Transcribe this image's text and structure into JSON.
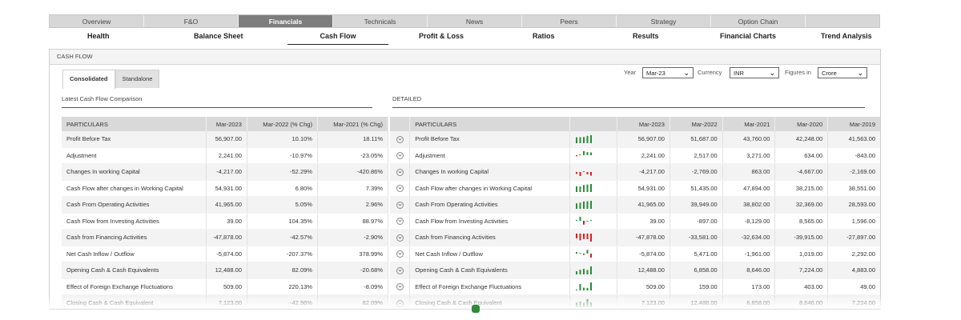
{
  "main_tabs": [
    {
      "label": "Overview"
    },
    {
      "label": "F&O"
    },
    {
      "label": "Financials"
    },
    {
      "label": "Technicals"
    },
    {
      "label": "News"
    },
    {
      "label": "Peers"
    },
    {
      "label": "Strategy"
    },
    {
      "label": "Option Chain"
    },
    {
      "label": ""
    }
  ],
  "sub_tabs": [
    {
      "label": "Health"
    },
    {
      "label": "Balance Sheet"
    },
    {
      "label": "Cash Flow"
    },
    {
      "label": "Profit & Loss"
    },
    {
      "label": "Ratios"
    },
    {
      "label": "Results"
    },
    {
      "label": "Financial Charts"
    },
    {
      "label": "Trend Analysis"
    }
  ],
  "panel_title": "CASH FLOW",
  "view_tabs": [
    {
      "label": "Consolidated"
    },
    {
      "label": "Standalone"
    }
  ],
  "controls": {
    "year_label": "Year",
    "year_value": "Mar-23",
    "currency_label": "Currency",
    "currency_value": "INR",
    "figures_label": "Figures in",
    "figures_value": "Crore"
  },
  "comparison": {
    "title": "Latest Cash Flow Comparison",
    "headers": [
      "PARTICULARS",
      "Mar-2023",
      "Mar-2022 (% Chg)",
      "Mar-2021 (% Chg)"
    ],
    "rows": [
      [
        "Profit Before Tax",
        "56,907.00",
        "10.10%",
        "18.11%"
      ],
      [
        "Adjustment",
        "2,241.00",
        "-10.97%",
        "-23.05%"
      ],
      [
        "Changes In working Capital",
        "-4,217.00",
        "-52.29%",
        "-420.86%"
      ],
      [
        "Cash Flow after changes in Working Capital",
        "54,931.00",
        "6.80%",
        "7.39%"
      ],
      [
        "Cash From Operating Activities",
        "41,965.00",
        "5.05%",
        "2.96%"
      ],
      [
        "Cash Flow from Investing Activities",
        "39.00",
        "104.35%",
        "88.97%"
      ],
      [
        "Cash from Financing Activities",
        "-47,878.00",
        "-42.57%",
        "-2.90%"
      ],
      [
        "Net Cash Inflow / Outflow",
        "-5,874.00",
        "-207.37%",
        "378.99%"
      ],
      [
        "Opening Cash & Cash Equivalents",
        "12,488.00",
        "82.09%",
        "-20.68%"
      ],
      [
        "Effect of Foreign Exchange Fluctuations",
        "509.00",
        "220.13%",
        "-8.09%"
      ],
      [
        "Closing Cash & Cash Equivalent",
        "7,123.00",
        "-42.96%",
        "82.09%"
      ]
    ]
  },
  "detailed": {
    "title": "DETAILED",
    "headers": [
      "PARTICULARS",
      "Mar-2023",
      "Mar-2022",
      "Mar-2021",
      "Mar-2020",
      "Mar-2019"
    ],
    "rows": [
      {
        "name": "Profit Before Tax",
        "values": [
          "56,907.00",
          "51,687.00",
          "43,760.00",
          "42,248.00",
          "41,563.00"
        ],
        "trend": [
          41563,
          42248,
          43760,
          51687,
          56907
        ]
      },
      {
        "name": "Adjustment",
        "values": [
          "2,241.00",
          "2,517.00",
          "3,271.00",
          "634.00",
          "-843.00"
        ],
        "trend": [
          -843,
          634,
          3271,
          2517,
          2241
        ]
      },
      {
        "name": "Changes In working Capital",
        "values": [
          "-4,217.00",
          "-2,769.00",
          "863.00",
          "-4,667.00",
          "-2,169.00"
        ],
        "trend": [
          -2169,
          -4667,
          863,
          -2769,
          -4217
        ]
      },
      {
        "name": "Cash Flow after changes in Working Capital",
        "values": [
          "54,931.00",
          "51,435.00",
          "47,894.00",
          "38,215.00",
          "38,551.00"
        ],
        "trend": [
          38551,
          38215,
          47894,
          51435,
          54931
        ]
      },
      {
        "name": "Cash From Operating Activities",
        "values": [
          "41,965.00",
          "39,949.00",
          "38,802.00",
          "32,369.00",
          "28,593.00"
        ],
        "trend": [
          28593,
          32369,
          38802,
          39949,
          41965
        ]
      },
      {
        "name": "Cash Flow from Investing Activities",
        "values": [
          "39.00",
          "-897.00",
          "-8,129.00",
          "8,565.00",
          "1,596.00"
        ],
        "trend": [
          1596,
          8565,
          -8129,
          -897,
          39
        ]
      },
      {
        "name": "Cash from Financing Activities",
        "values": [
          "-47,878.00",
          "-33,581.00",
          "-32,634.00",
          "-39,915.00",
          "-27,897.00"
        ],
        "trend": [
          -27897,
          -39915,
          -32634,
          -33581,
          -47878
        ]
      },
      {
        "name": "Net Cash Inflow / Outflow",
        "values": [
          "-5,874.00",
          "5,471.00",
          "-1,961.00",
          "1,019.00",
          "2,292.00"
        ],
        "trend": [
          2292,
          1019,
          -1961,
          5471,
          -5874
        ]
      },
      {
        "name": "Opening Cash & Cash Equivalents",
        "values": [
          "12,488.00",
          "6,858.00",
          "8,646.00",
          "7,224.00",
          "4,883.00"
        ],
        "trend": [
          4883,
          7224,
          8646,
          6858,
          12488
        ]
      },
      {
        "name": "Effect of Foreign Exchange Fluctuations",
        "values": [
          "509.00",
          "159.00",
          "173.00",
          "403.00",
          "49.00"
        ],
        "trend": [
          49,
          403,
          173,
          159,
          509
        ]
      },
      {
        "name": "Closing Cash & Cash Equivalent",
        "values": [
          "7,123.00",
          "12,488.00",
          "6,858.00",
          "8,646.00",
          "7,224.00"
        ],
        "trend": [
          7224,
          8646,
          6858,
          12488,
          7123
        ]
      }
    ]
  },
  "colors": {
    "positive": "#2e8b3a",
    "negative": "#d62020",
    "active_tab": "#7d7d7d"
  }
}
